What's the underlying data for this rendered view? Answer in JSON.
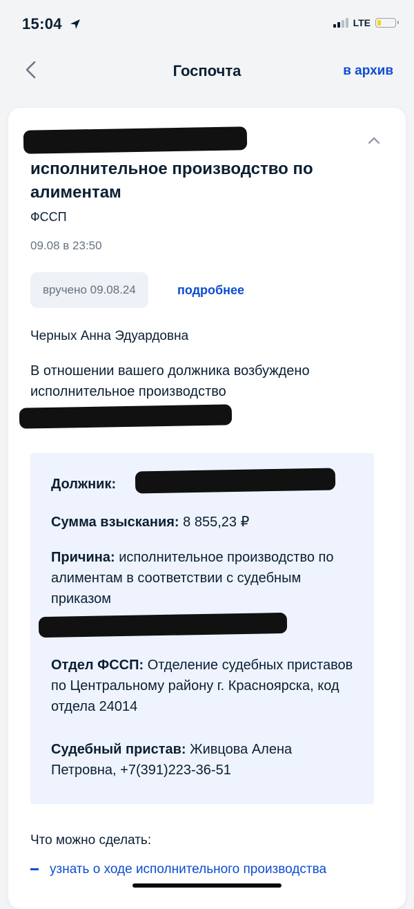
{
  "status_bar": {
    "time": "15:04",
    "network": "LTE",
    "icons": [
      "location-arrow-icon",
      "signal-icon",
      "battery-icon"
    ]
  },
  "nav": {
    "title": "Госпочта",
    "archive_label": "в архив",
    "back_icon": "chevron-left-icon"
  },
  "message": {
    "title": "исполнительное производство по алиментам",
    "sender": "ФССП",
    "date": "09.08 в 23:50",
    "status": "вручено 09.08.24",
    "details_label": "подробнее",
    "recipient": "Черных Анна Эдуардовна",
    "intro": "В отношении вашего должника возбуждено исполнительное производство"
  },
  "info": {
    "debtor_label": "Должник:",
    "amount_label": "Сумма взыскания:",
    "amount_value": "8 855,23 ₽",
    "reason_label": "Причина:",
    "reason_value": "исполнительное производство по алиментам в соответствии с судебным приказом",
    "department_label": "Отдел ФССП:",
    "department_value": "Отделение судебных приставов по Центральному району г. Красноярска, код отдела 24014",
    "bailiff_label": "Судебный пристав:",
    "bailiff_value": "Живцова Алена Петровна, +7(391)223-36-51"
  },
  "actions": {
    "title": "Что можно сделать:",
    "items": [
      {
        "label": "узнать о ходе исполнительного производства"
      }
    ]
  },
  "colors": {
    "accent": "#0d4cd3",
    "info_box_bg": "#eef3fd",
    "badge_bg": "#eef1f5",
    "battery_fill": "#f5d90a"
  }
}
